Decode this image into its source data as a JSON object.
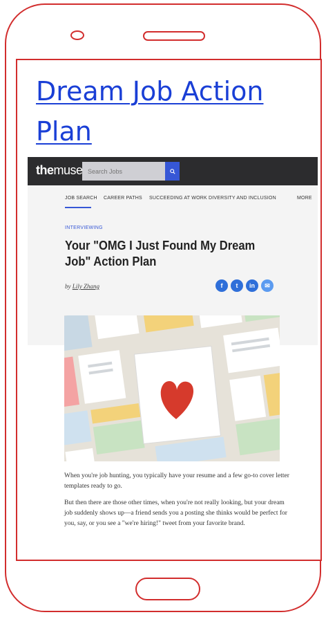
{
  "page": {
    "title": "Dream Job Action Plan"
  },
  "site": {
    "logo_bold": "the",
    "logo_light": "muse",
    "search_placeholder": "Search Jobs"
  },
  "nav": {
    "items": [
      "JOB SEARCH",
      "CAREER PATHS",
      "SUCCEEDING AT WORK",
      "DIVERSITY AND INCLUSION",
      "MORE"
    ]
  },
  "article": {
    "category": "INTERVIEWING",
    "title": "Your \"OMG I Just Found My Dream Job\" Action Plan",
    "by": "by",
    "author": "Lily Zhang",
    "paragraphs": [
      "When you're job hunting, you typically have your resume and a few go-to cover letter templates ready to go.",
      "But then there are those other times, when you're not really looking, but your dream job suddenly shows up—a friend sends you a posting she thinks would be perfect for you, say, or you see a \"we're hiring!\" tweet from your favorite brand."
    ]
  },
  "social": {
    "icons": [
      "facebook-icon",
      "twitter-icon",
      "linkedin-icon",
      "email-icon"
    ],
    "glyphs": [
      "f",
      "t",
      "in",
      "✉"
    ]
  },
  "colors": {
    "frame": "#d22d2d",
    "title_link": "#1a3fd6",
    "muse_bar": "#2c2c2e",
    "accent": "#3657d6",
    "heart": "#d63a2c"
  }
}
